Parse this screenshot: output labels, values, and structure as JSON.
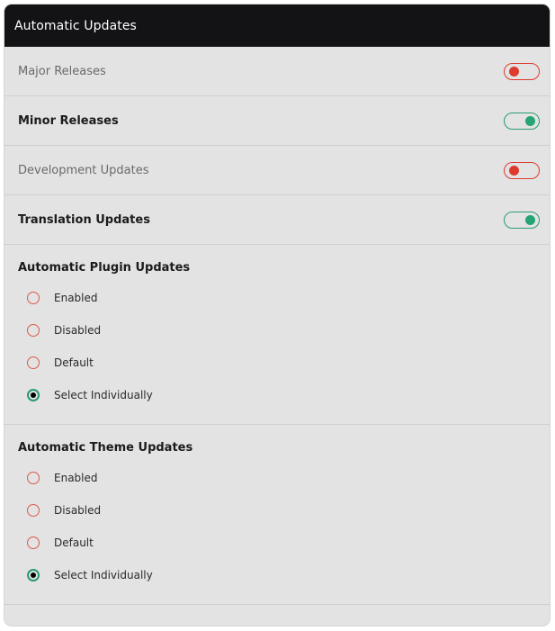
{
  "header": {
    "title": "Automatic Updates"
  },
  "toggles": [
    {
      "label": "Major Releases",
      "state": "off"
    },
    {
      "label": "Minor Releases",
      "state": "on"
    },
    {
      "label": "Development Updates",
      "state": "off"
    },
    {
      "label": "Translation Updates",
      "state": "on"
    }
  ],
  "plugin_updates": {
    "title": "Automatic Plugin Updates",
    "options": [
      "Enabled",
      "Disabled",
      "Default",
      "Select Individually"
    ],
    "selected": "Select Individually"
  },
  "theme_updates": {
    "title": "Automatic Theme Updates",
    "options": [
      "Enabled",
      "Disabled",
      "Default",
      "Select Individually"
    ],
    "selected": "Select Individually"
  },
  "colors": {
    "header_bg": "#131316",
    "panel_bg": "#e3e3e3",
    "toggle_off": "#dd3b2f",
    "toggle_on": "#27a474"
  }
}
